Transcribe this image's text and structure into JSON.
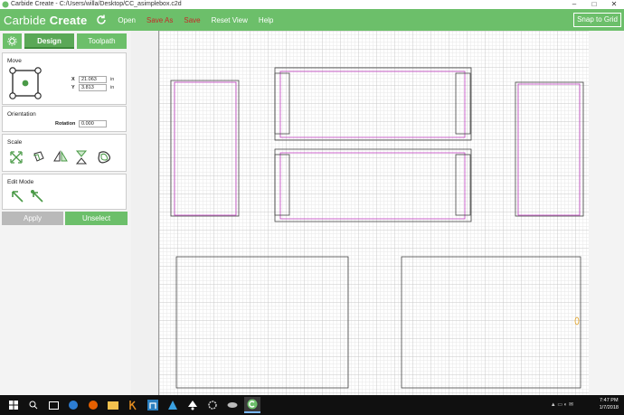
{
  "window": {
    "title": "Carbide Create - C:/Users/willa/Desktop/CC_asimplebox.c2d",
    "controls": [
      "–",
      "□",
      "✕"
    ]
  },
  "menubar": {
    "logo_light": "Carbide ",
    "logo_bold": "Create",
    "items": [
      "Open",
      "Save As",
      "Save",
      "Reset View",
      "Help"
    ],
    "snap_label": "Snap to Grid",
    "accent": "#6cbf6a",
    "warn": "#c62828"
  },
  "sidebar": {
    "tabs": [
      "Design",
      "Toolpath"
    ],
    "move": {
      "header": "Move",
      "x_label": "X",
      "x_value": "21.063",
      "y_label": "Y",
      "y_value": "3.813",
      "unit": "in"
    },
    "orientation": {
      "header": "Orientation",
      "rotation_label": "Rotation",
      "rotation_value": "0.000"
    },
    "scale": {
      "header": "Scale"
    },
    "edit_mode": {
      "header": "Edit Mode"
    },
    "apply_label": "Apply",
    "unselect_label": "Unselect"
  },
  "taskbar": {
    "time": "7:47 PM",
    "date": "1/7/2018"
  }
}
